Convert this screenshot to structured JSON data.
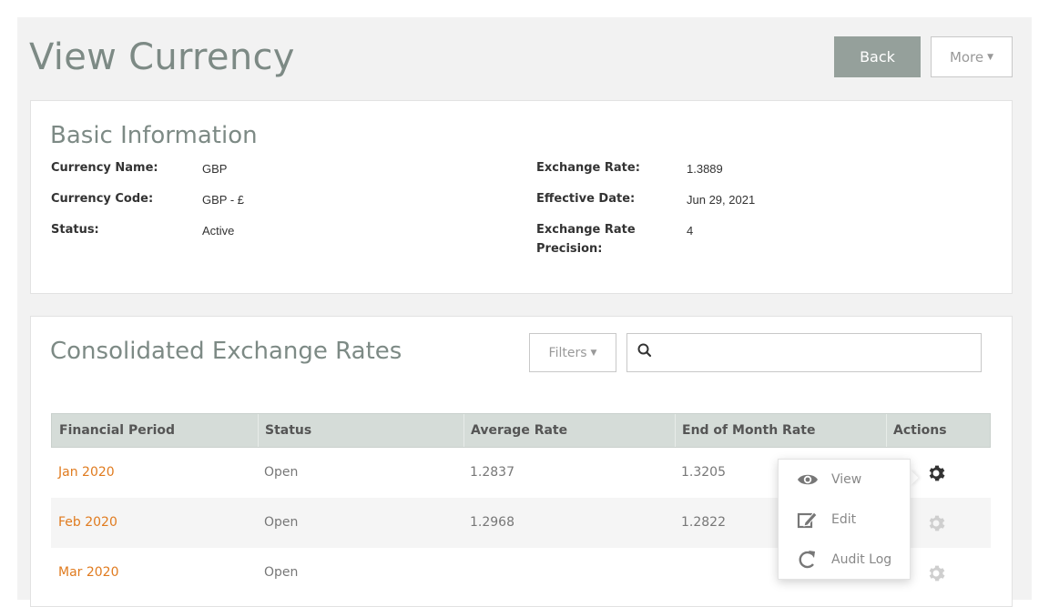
{
  "page": {
    "title": "View Currency"
  },
  "header": {
    "back_label": "Back",
    "more_label": "More"
  },
  "basic_info": {
    "title": "Basic Information",
    "fields_left": [
      {
        "label": "Currency Name:",
        "value": "GBP"
      },
      {
        "label": "Currency Code:",
        "value": "GBP - £"
      },
      {
        "label": "Status:",
        "value": "Active"
      }
    ],
    "fields_right": [
      {
        "label": "Exchange Rate:",
        "value": "1.3889"
      },
      {
        "label": "Effective Date:",
        "value": "Jun 29, 2021"
      },
      {
        "label_line1": "Exchange Rate",
        "label_line2": "Precision:",
        "value": "4"
      }
    ]
  },
  "rates": {
    "title": "Consolidated Exchange Rates",
    "filters_label": "Filters",
    "search": {
      "value": "",
      "placeholder": ""
    },
    "columns": [
      "Financial Period",
      "Status",
      "Average Rate",
      "End of Month Rate",
      "Actions"
    ],
    "rows": [
      {
        "period": "Jan 2020",
        "status": "Open",
        "avg": "1.2837",
        "eom": "1.3205"
      },
      {
        "period": "Feb 2020",
        "status": "Open",
        "avg": "1.2968",
        "eom": "1.2822"
      },
      {
        "period": "Mar 2020",
        "status": "Open",
        "avg": "",
        "eom": ""
      }
    ]
  },
  "actions_menu": {
    "items": [
      {
        "label": "View",
        "icon": "eye-icon"
      },
      {
        "label": "Edit",
        "icon": "edit-icon"
      },
      {
        "label": "Audit Log",
        "icon": "refresh-icon"
      }
    ]
  },
  "colors": {
    "accent_title": "#7d8a85",
    "link": "#e07b1f",
    "table_header": "#d5dcd8",
    "back_button": "#95a09b"
  }
}
